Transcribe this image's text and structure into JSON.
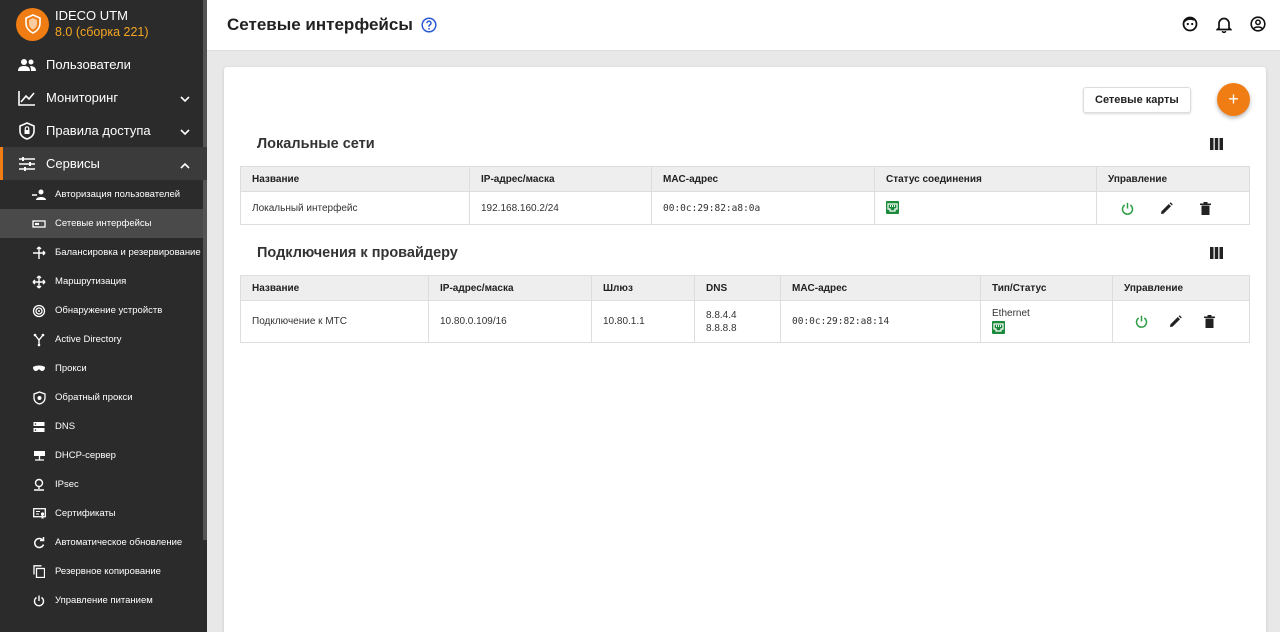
{
  "brand": {
    "name": "IDECO UTM",
    "version": "8.0 (сборка 221)"
  },
  "sidebar": {
    "top": [
      {
        "label": "Пользователи"
      },
      {
        "label": "Мониторинг"
      },
      {
        "label": "Правила доступа"
      },
      {
        "label": "Сервисы"
      }
    ],
    "sub": [
      {
        "label": "Авторизация пользователей"
      },
      {
        "label": "Сетевые интерфейсы"
      },
      {
        "label": "Балансировка и резервирование"
      },
      {
        "label": "Маршрутизация"
      },
      {
        "label": "Обнаружение устройств"
      },
      {
        "label": "Active Directory"
      },
      {
        "label": "Прокси"
      },
      {
        "label": "Обратный прокси"
      },
      {
        "label": "DNS"
      },
      {
        "label": "DHCP-сервер"
      },
      {
        "label": "IPsec"
      },
      {
        "label": "Сертификаты"
      },
      {
        "label": "Автоматическое обновление"
      },
      {
        "label": "Резервное копирование"
      },
      {
        "label": "Управление питанием"
      }
    ]
  },
  "header": {
    "title": "Сетевые интерфейсы"
  },
  "toolbar": {
    "cards_label": "Сетевые карты",
    "add_label": "+"
  },
  "local": {
    "title": "Локальные сети",
    "columns": [
      "Название",
      "IP-адрес/маска",
      "MAC-адрес",
      "Статус соединения",
      "Управление"
    ],
    "rows": [
      {
        "name": "Локальный интерфейс",
        "ip": "192.168.160.2/24",
        "mac": "00:0c:29:82:a8:0a"
      }
    ]
  },
  "provider": {
    "title": "Подключения к провайдеру",
    "columns": [
      "Название",
      "IP-адрес/маска",
      "Шлюз",
      "DNS",
      "MAC-адрес",
      "Тип/Статус",
      "Управление"
    ],
    "rows": [
      {
        "name": "Подключение к МТС",
        "ip": "10.80.0.109/16",
        "gateway": "10.80.1.1",
        "dns1": "8.8.4.4",
        "dns2": "8.8.8.8",
        "mac": "00:0c:29:82:a8:14",
        "type": "Ethernet"
      }
    ]
  },
  "colors": {
    "accent": "#ef7d14",
    "sidebar": "#2b2b2b",
    "status_green": "#1b8a3a",
    "power_green": "#2e9e44",
    "help_blue": "#2d5bd2"
  }
}
